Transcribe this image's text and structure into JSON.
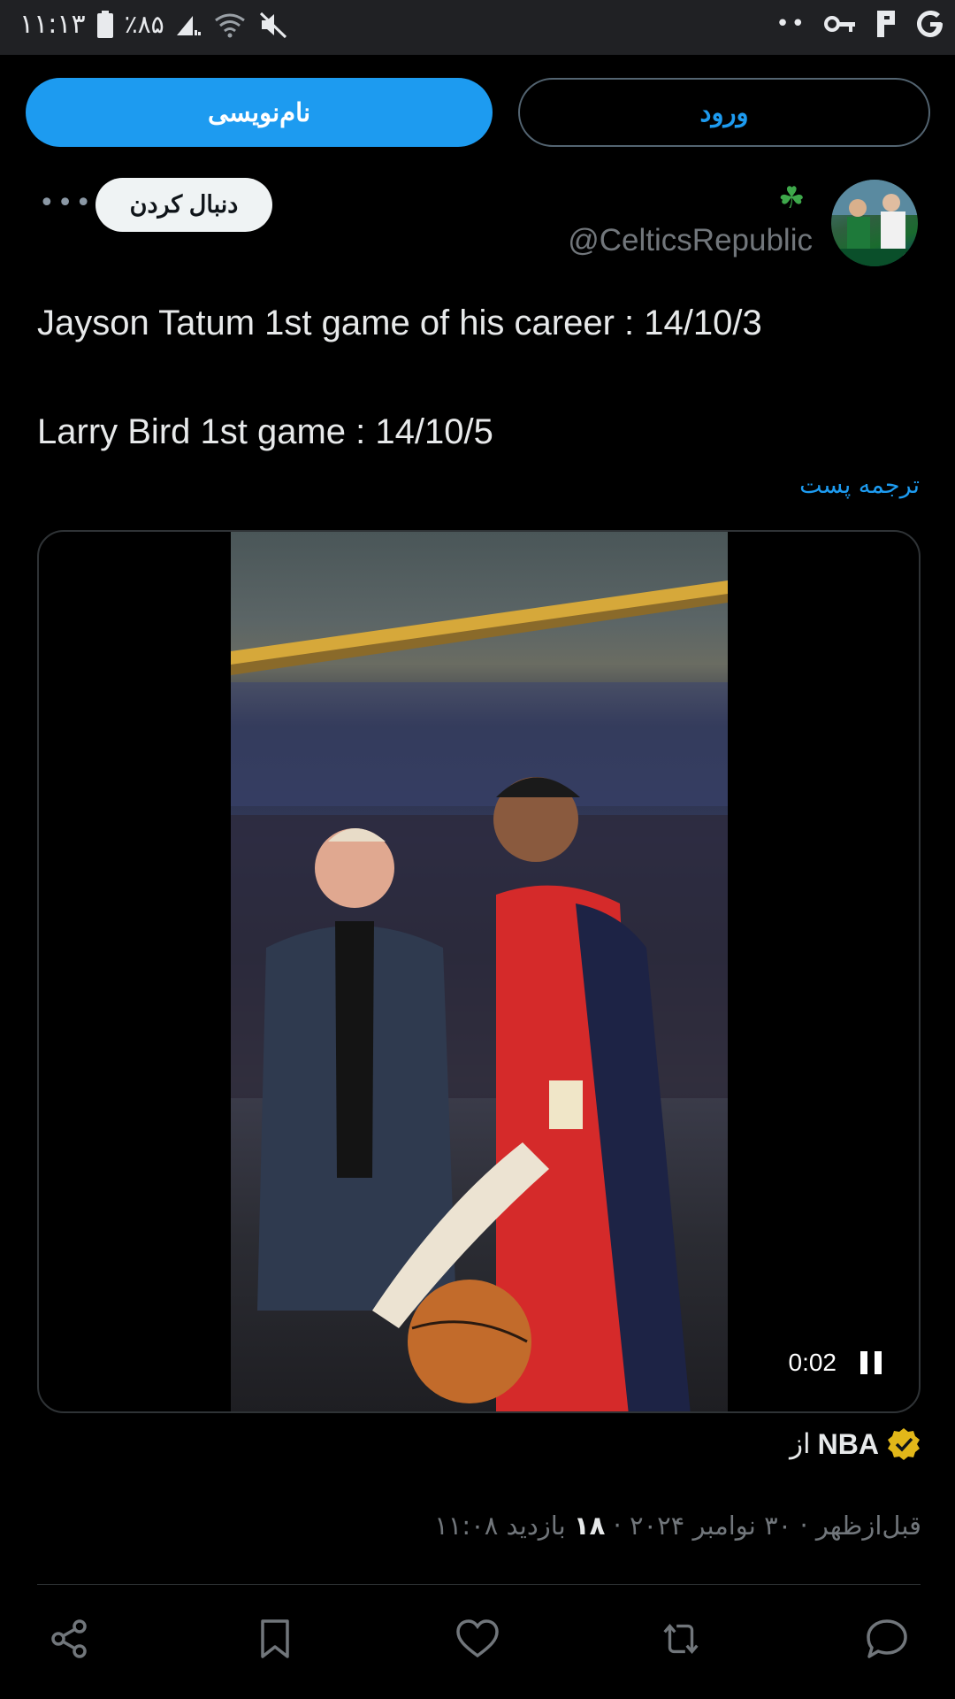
{
  "status_bar": {
    "time": "۱۱:۱۳",
    "battery": "٪۸۵",
    "right_dots": "••"
  },
  "auth": {
    "signup_label": "نام‌نویسی",
    "login_label": "ورود"
  },
  "author": {
    "handle": "@CelticsRepublic",
    "name_emoji": "☘",
    "follow_label": "دنبال کردن",
    "more_label": "•••"
  },
  "tweet": {
    "line1": "Jayson Tatum 1st game of his career : 14/10/3",
    "line2": "Larry Bird 1st game : 14/10/5",
    "translate_label": "ترجمه پست"
  },
  "media": {
    "time": "0:02",
    "state": "playing"
  },
  "source": {
    "prefix": "از",
    "name": "NBA"
  },
  "meta": {
    "time_date": "۱۱:۰۸ قبل‌ازظهر · ۳۰ نوامبر ۲۰۲۴ · ",
    "views_count": "۱۸",
    "views_label": " بازدید"
  },
  "actions": [
    "share-icon",
    "bookmark-icon",
    "like-icon",
    "retweet-icon",
    "reply-icon"
  ],
  "colors": {
    "accent": "#1d9bf0",
    "background": "#000000",
    "muted": "#71767b",
    "verified": "#e2b719"
  }
}
